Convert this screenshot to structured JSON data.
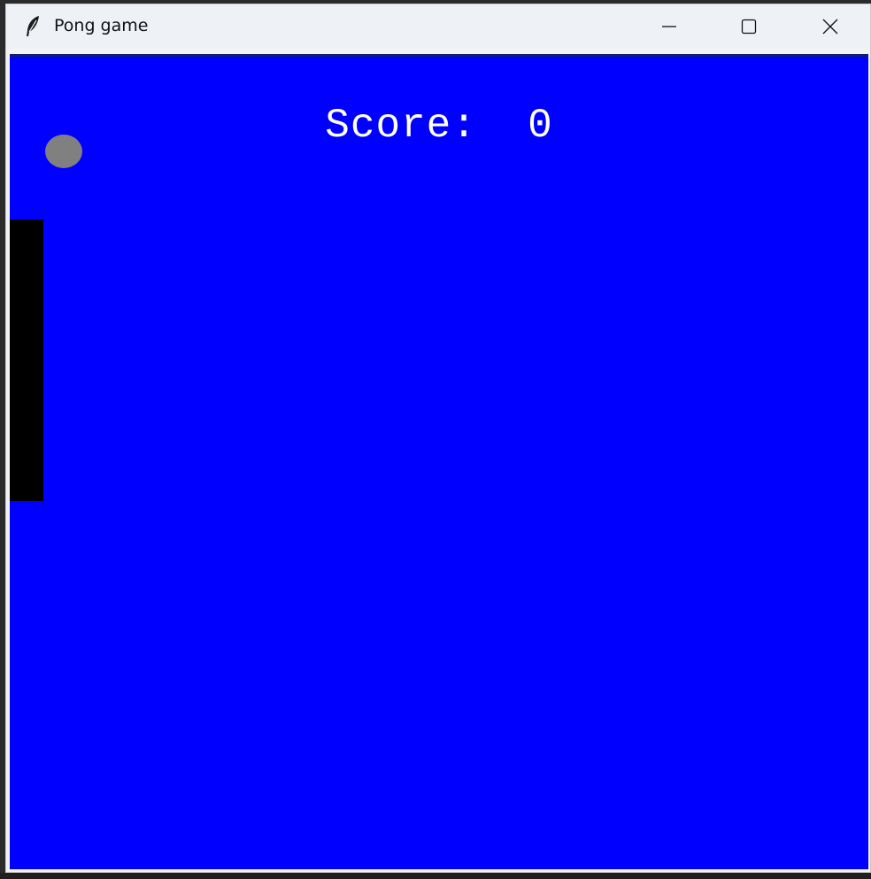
{
  "window": {
    "title": "Pong game",
    "app_icon": "feather-icon",
    "controls": {
      "minimize_icon": "minimize-icon",
      "maximize_icon": "maximize-icon",
      "close_icon": "close-icon"
    }
  },
  "game": {
    "score_label": "Score:",
    "score_value": "0",
    "background_color": "#0000ff",
    "ball_color": "#808080",
    "paddle_color": "#000000",
    "score_color": "#ffffff"
  }
}
